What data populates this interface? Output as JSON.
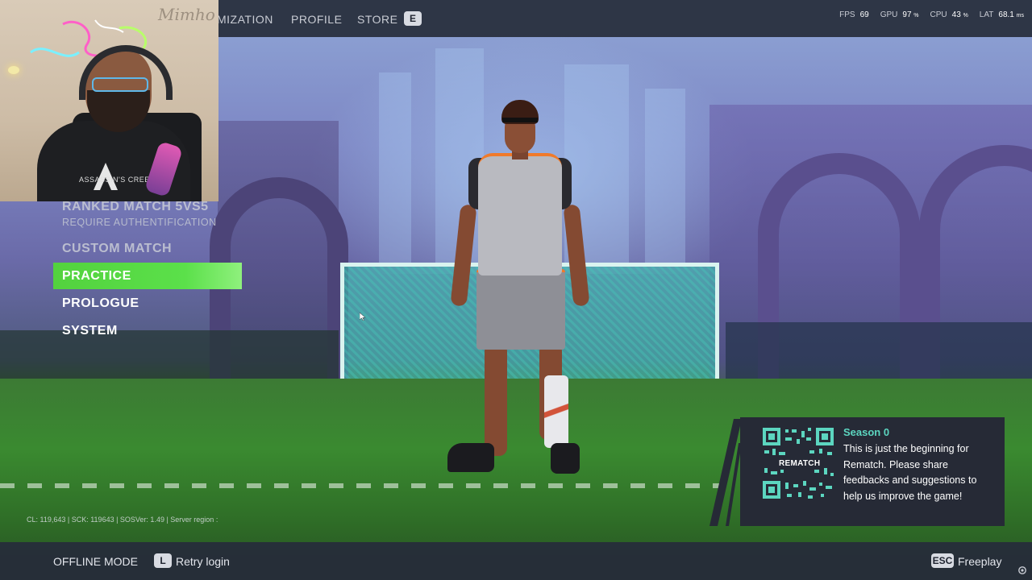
{
  "topbar": {
    "nav": [
      "MIZATION",
      "PROFILE",
      "STORE"
    ],
    "store_key": "E",
    "stats": [
      {
        "label": "FPS",
        "value": "69",
        "unit": ""
      },
      {
        "label": "GPU",
        "value": "97",
        "unit": "%"
      },
      {
        "label": "CPU",
        "value": "43",
        "unit": "%"
      },
      {
        "label": "LAT",
        "value": "68.1",
        "unit": "ms"
      }
    ]
  },
  "webcam": {
    "sign": "Mimho",
    "shirt_text": "ASSASSIN'S CREED"
  },
  "menu": {
    "ranked": "RANKED MATCH 5VS5",
    "ranked_sub": "REQUIRE AUTHENTIFICATION",
    "custom": "CUSTOM MATCH",
    "practice": "PRACTICE",
    "prologue": "PROLOGUE",
    "system": "SYSTEM"
  },
  "build_info": "CL: 119,643 | SCK: 119643 | SOSVer: 1.49 | Server region :",
  "season": {
    "title": "Season 0",
    "text": "This is just the beginning for Rematch. Please share feedbacks and suggestions to help us improve the game!",
    "qr_label": "REMATCH"
  },
  "bottom": {
    "offline": "OFFLINE MODE",
    "retry_key": "L",
    "retry": "Retry login",
    "esc_key": "ESC",
    "freeplay": "Freeplay"
  },
  "colors": {
    "accent_green": "#53d23e",
    "season_teal": "#5cd6c0",
    "bar_bg": "#262c3a"
  },
  "icons": [
    "gear-icon",
    "cursor-icon",
    "qr-code-icon"
  ]
}
